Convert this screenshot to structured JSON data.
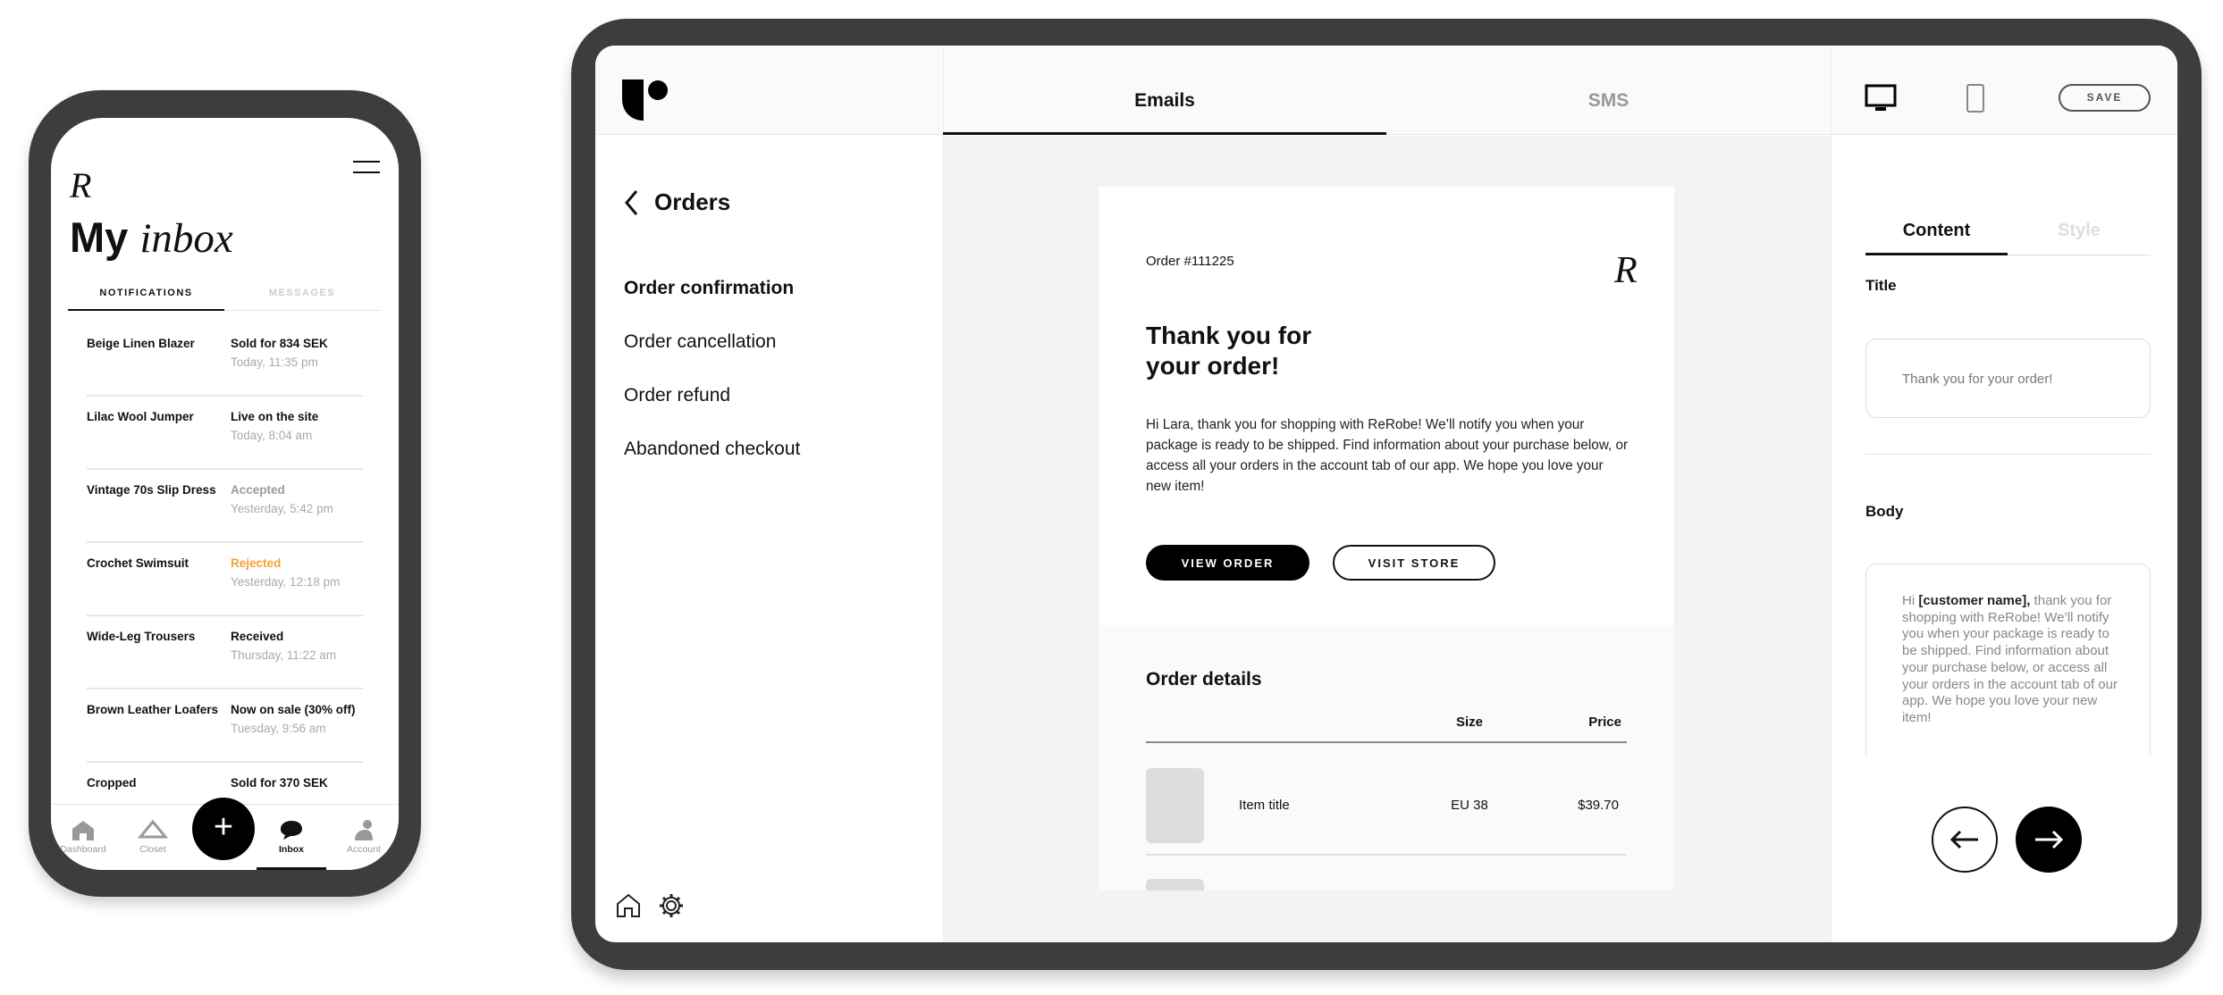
{
  "phone": {
    "logo": "R",
    "title_bold": "My",
    "title_italic": "inbox",
    "tabs": [
      {
        "label": "NOTIFICATIONS",
        "active": true
      },
      {
        "label": "MESSAGES",
        "active": false
      }
    ],
    "notifications": [
      {
        "item": "Beige Linen Blazer",
        "status": "Sold for 834 SEK",
        "time": "Today, 11:35 pm",
        "status_color": "#111111"
      },
      {
        "item": "Lilac Wool Jumper",
        "status": "Live on the site",
        "time": "Today, 8:04 am",
        "status_color": "#111111"
      },
      {
        "item": "Vintage 70s Slip Dress",
        "status": "Accepted",
        "time": "Yesterday, 5:42 pm",
        "status_color": "#999999"
      },
      {
        "item": "Crochet Swimsuit",
        "status": "Rejected",
        "time": "Yesterday, 12:18 pm",
        "status_color": "#f5a033"
      },
      {
        "item": "Wide-Leg Trousers",
        "status": "Received",
        "time": "Thursday, 11:22 am",
        "status_color": "#111111"
      },
      {
        "item": "Brown Leather Loafers",
        "status": "Now on sale (30% off)",
        "time": "Tuesday, 9:56 am",
        "status_color": "#111111"
      },
      {
        "item": "Cropped",
        "status": "Sold for 370 SEK",
        "time": "",
        "status_color": "#111111"
      }
    ],
    "bottom_nav": [
      {
        "label": "Dashboard",
        "icon": "home-icon"
      },
      {
        "label": "Closet",
        "icon": "hanger-icon"
      },
      {
        "label": "+",
        "icon": "plus-icon"
      },
      {
        "label": "Inbox",
        "icon": "chat-bubble-icon",
        "active": true
      },
      {
        "label": "Account",
        "icon": "person-icon"
      }
    ]
  },
  "tablet": {
    "tabs": [
      {
        "label": "Emails",
        "active": true
      },
      {
        "label": "SMS",
        "active": false
      }
    ],
    "toolbar": {
      "desktop_icon": "desktop-icon",
      "tablet_icon": "tablet-icon",
      "save_label": "SAVE"
    },
    "sidebar": {
      "back_title": "Orders",
      "items": [
        {
          "label": "Order confirmation",
          "active": true
        },
        {
          "label": "Order cancellation"
        },
        {
          "label": "Order refund"
        },
        {
          "label": "Abandoned checkout"
        }
      ]
    },
    "email": {
      "order_number": "Order #111225",
      "logo": "R",
      "title_line1": "Thank you for",
      "title_line2": "your order!",
      "body": "Hi Lara, thank you for shopping with ReRobe! We’ll notify you when your package is ready to be shipped. Find information about your purchase below, or access all your orders in the account tab of our app. We hope you love your new item!",
      "primary_button": "VIEW ORDER",
      "secondary_button": "VISIT STORE",
      "details_title": "Order details",
      "columns": [
        "Size",
        "Price"
      ],
      "items": [
        {
          "title": "Item title",
          "size": "EU 38",
          "price": "$39.70"
        }
      ]
    },
    "editor": {
      "tabs": [
        {
          "label": "Content",
          "active": true
        },
        {
          "label": "Style",
          "active": false
        }
      ],
      "title_label": "Title",
      "title_value": "Thank you for your order!",
      "body_label": "Body",
      "body_prefix": "Hi ",
      "body_variable": "[customer name],",
      "body_rest": " thank you for shopping with ReRobe! We’ll notify you when your package is ready to be shipped. Find information about your purchase below, or access all your orders in the account tab of our app. We hope you love your new item!"
    }
  }
}
